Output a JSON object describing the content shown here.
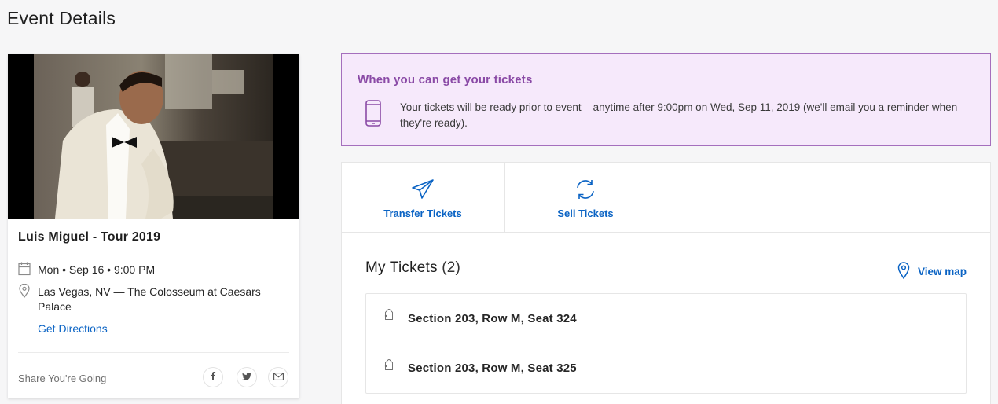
{
  "page": {
    "title": "Event Details"
  },
  "event": {
    "name": "Luis Miguel - Tour 2019",
    "date": "Mon • Sep 16 • 9:00 PM",
    "venue": "Las Vegas, NV — The Colosseum at Caesars Palace",
    "directions_label": "Get Directions",
    "share_label": "Share You're Going",
    "share_icons": [
      "facebook-icon",
      "twitter-icon",
      "email-icon"
    ]
  },
  "notice": {
    "title": "When you can get your tickets",
    "text": "Your tickets will be ready prior to event – anytime after 9:00pm on Wed, Sep 11, 2019 (we'll email you a reminder when they're ready)."
  },
  "actions": {
    "transfer_label": "Transfer Tickets",
    "sell_label": "Sell Tickets"
  },
  "tickets": {
    "heading": "My Tickets",
    "count": "(2)",
    "view_map_label": "View map",
    "seats": [
      {
        "label": "Section 203, Row M, Seat 324"
      },
      {
        "label": "Section 203, Row M, Seat 325"
      }
    ]
  },
  "colors": {
    "accent_blue": "#0a63c4",
    "notice_bg": "#f6e9fb",
    "notice_border": "#a56fbd",
    "notice_title": "#8a4aa6"
  }
}
